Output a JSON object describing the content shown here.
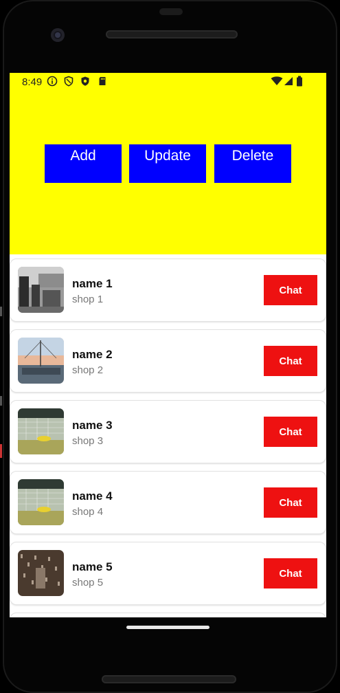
{
  "status_bar": {
    "time": "8:49",
    "left_icons": [
      "info-icon",
      "shield-icon",
      "shield-filled-icon",
      "sd-card-icon"
    ],
    "right_icons": [
      "wifi-icon",
      "cell-signal-icon",
      "battery-icon"
    ]
  },
  "header": {
    "background": "#ffff00",
    "buttons": [
      {
        "label": "Add"
      },
      {
        "label": "Update"
      },
      {
        "label": "Delete"
      }
    ],
    "button_color": "#0000ff"
  },
  "list": {
    "items": [
      {
        "name": "name 1",
        "shop": "shop 1",
        "button": "Chat",
        "image": "grayscale street scene photo"
      },
      {
        "name": "name 2",
        "shop": "shop 2",
        "button": "Chat",
        "image": "harbor with boats photo"
      },
      {
        "name": "name 3",
        "shop": "shop 3",
        "button": "Chat",
        "image": "soccer goalkeeper photo"
      },
      {
        "name": "name 4",
        "shop": "shop 4",
        "button": "Chat",
        "image": "soccer goalkeeper photo"
      },
      {
        "name": "name 5",
        "shop": "shop 5",
        "button": "Chat",
        "image": "rain curtain photo"
      }
    ],
    "chat_button_color": "#ee1111"
  }
}
